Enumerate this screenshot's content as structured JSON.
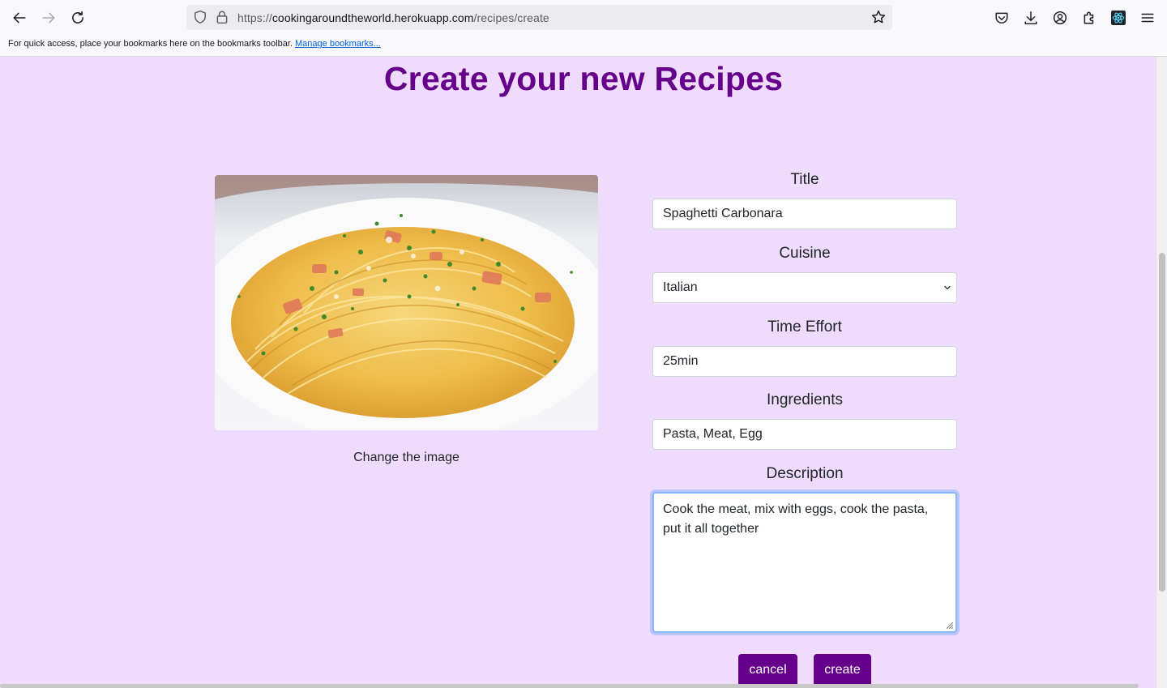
{
  "browser": {
    "url_prefix": "https://",
    "url_host": "cookingaroundtheworld.herokuapp.com",
    "url_path": "/recipes/create",
    "bookmarks_message": "For quick access, place your bookmarks here on the bookmarks toolbar.",
    "bookmarks_link": "Manage bookmarks..."
  },
  "page": {
    "title": "Create your new Recipes",
    "change_image_label": "Change the image",
    "image_alt": "Spaghetti Carbonara dish",
    "accent_color": "#66008b",
    "background_color": "#efdcfd"
  },
  "form": {
    "title_label": "Title",
    "title_value": "Spaghetti Carbonara",
    "cuisine_label": "Cuisine",
    "cuisine_value": "Italian",
    "time_label": "Time Effort",
    "time_value": "25min",
    "ingredients_label": "Ingredients",
    "ingredients_value": "Pasta, Meat, Egg",
    "description_label": "Description",
    "description_value": "Cook the meat, mix with eggs, cook the pasta, put it all together"
  },
  "actions": {
    "cancel_label": "cancel",
    "create_label": "create"
  },
  "icons": {
    "back": "arrow-left-icon",
    "forward": "arrow-right-icon",
    "reload": "reload-icon",
    "shield": "shield-icon",
    "lock": "lock-icon",
    "star": "star-icon",
    "pocket": "pocket-icon",
    "download": "download-icon",
    "account": "account-icon",
    "extensions": "puzzle-icon",
    "react": "react-devtools-icon",
    "menu": "hamburger-menu-icon"
  }
}
